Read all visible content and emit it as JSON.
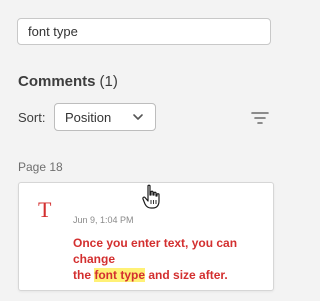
{
  "search": {
    "value": "font type",
    "placeholder": ""
  },
  "comments": {
    "title": "Comments",
    "count": "(1)"
  },
  "sort": {
    "label": "Sort:",
    "selected": "Position"
  },
  "page_group": {
    "label": "Page 18"
  },
  "comment": {
    "icon": "T",
    "icon_name": "text-type-icon",
    "timestamp": "Jun 9, 1:04 PM",
    "text_line1": "Once you enter text, you can change",
    "text_prefix": "the ",
    "text_highlight": "font type",
    "text_suffix": " and size after."
  },
  "colors": {
    "accent": "#d32f2f",
    "highlight": "#fff176",
    "background": "#f3f3f3"
  }
}
